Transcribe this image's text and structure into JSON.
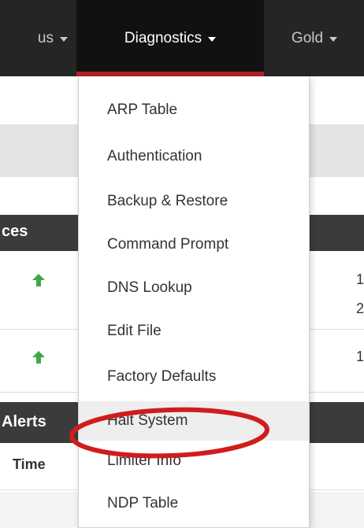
{
  "navbar": {
    "items": [
      {
        "label": "us"
      },
      {
        "label": "Diagnostics"
      },
      {
        "label": "Gold"
      }
    ]
  },
  "background": {
    "interfaces_header": "ces",
    "alerts_header": "Alerts",
    "time_column": "Time",
    "edge_text": [
      "1",
      "2",
      "1"
    ]
  },
  "dropdown": {
    "items": [
      {
        "label": "ARP Table"
      },
      {
        "label": "Authentication"
      },
      {
        "label": "Backup & Restore"
      },
      {
        "label": "Command Prompt"
      },
      {
        "label": "DNS Lookup"
      },
      {
        "label": "Edit File"
      },
      {
        "label": "Factory Defaults"
      },
      {
        "label": "Halt System"
      },
      {
        "label": "Limiter Info"
      },
      {
        "label": "NDP Table"
      }
    ]
  },
  "colors": {
    "navbar_bg": "#252525",
    "active_tab_bg": "#111111",
    "active_tab_underline": "#b02027",
    "annotation_circle": "#d01c1c",
    "status_up": "#3fa64a"
  },
  "icons": [
    "caret-down-icon",
    "arrow-up-icon"
  ]
}
